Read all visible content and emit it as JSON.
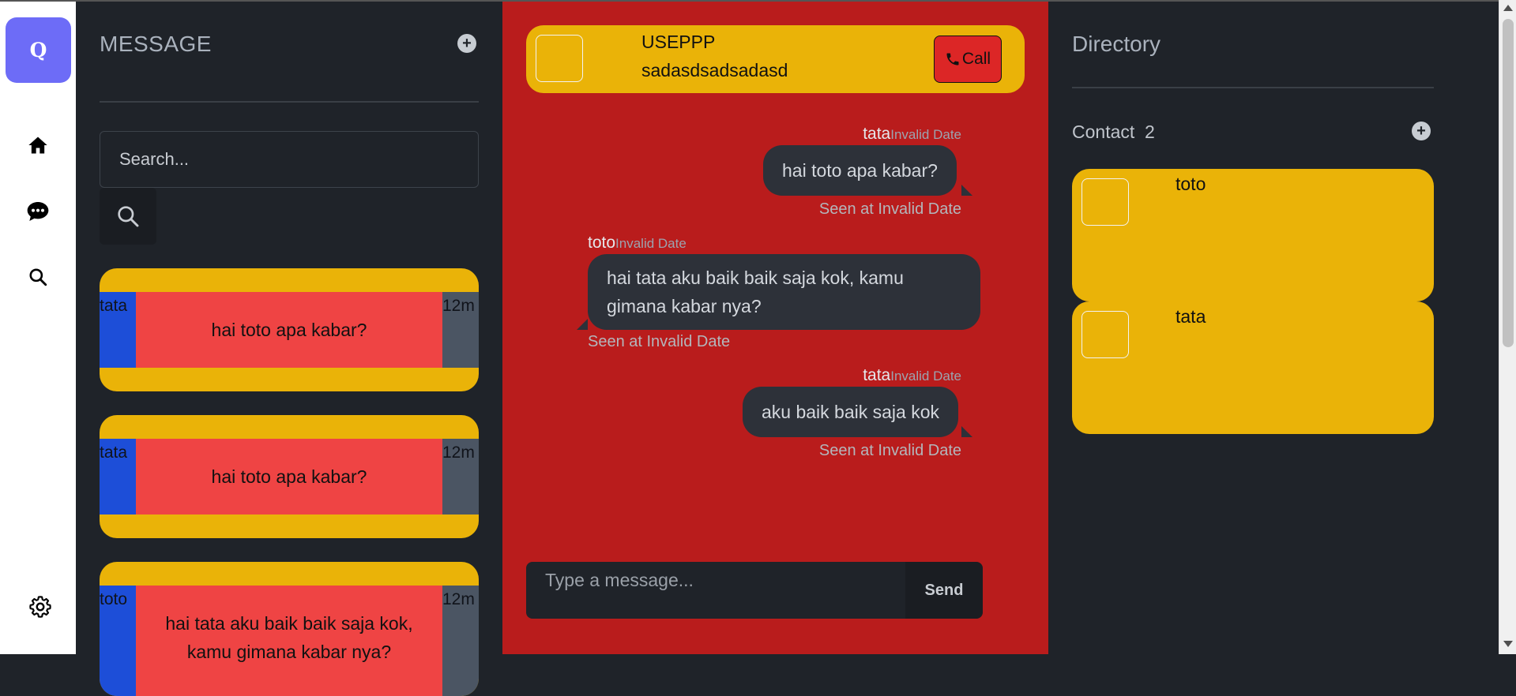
{
  "rail": {
    "logo": "Q",
    "icons": [
      "home-icon",
      "chat-bubble-icon",
      "search-icon",
      "gear-icon"
    ]
  },
  "messages": {
    "title": "MESSAGE",
    "search_placeholder": "Search...",
    "conversations": [
      {
        "name": "tata",
        "text": "hai toto apa kabar?",
        "time": "12m"
      },
      {
        "name": "tata",
        "text": "hai toto apa kabar?",
        "time": "12m"
      },
      {
        "name": "toto",
        "text": "hai tata aku baik baik saja kok, kamu gimana kabar nya?",
        "time": "12m"
      }
    ]
  },
  "chat": {
    "header": {
      "name": "USEPPP",
      "subtitle": "sadasdsadsadasd",
      "call_label": "Call"
    },
    "messages": [
      {
        "sender": "tata",
        "date": "Invalid Date",
        "text": "hai toto apa kabar?",
        "seen": "Seen at Invalid Date"
      },
      {
        "sender": "toto",
        "date": "Invalid Date",
        "text": "hai tata aku baik baik saja kok, kamu gimana kabar nya?",
        "seen": "Seen at Invalid Date"
      },
      {
        "sender": "tata",
        "date": "Invalid Date",
        "text": "aku baik baik saja kok",
        "seen": "Seen at Invalid Date"
      }
    ],
    "compose_placeholder": "Type a message...",
    "send_label": "Send"
  },
  "directory": {
    "title": "Directory",
    "contact_label": "Contact",
    "contact_count": "2",
    "contacts": [
      {
        "name": "toto"
      },
      {
        "name": "tata"
      }
    ]
  },
  "colors": {
    "accent_yellow": "#eab308",
    "chat_red": "#b91c1c",
    "logo_purple": "#6d6cf7",
    "panel_dark": "#1f2329"
  }
}
